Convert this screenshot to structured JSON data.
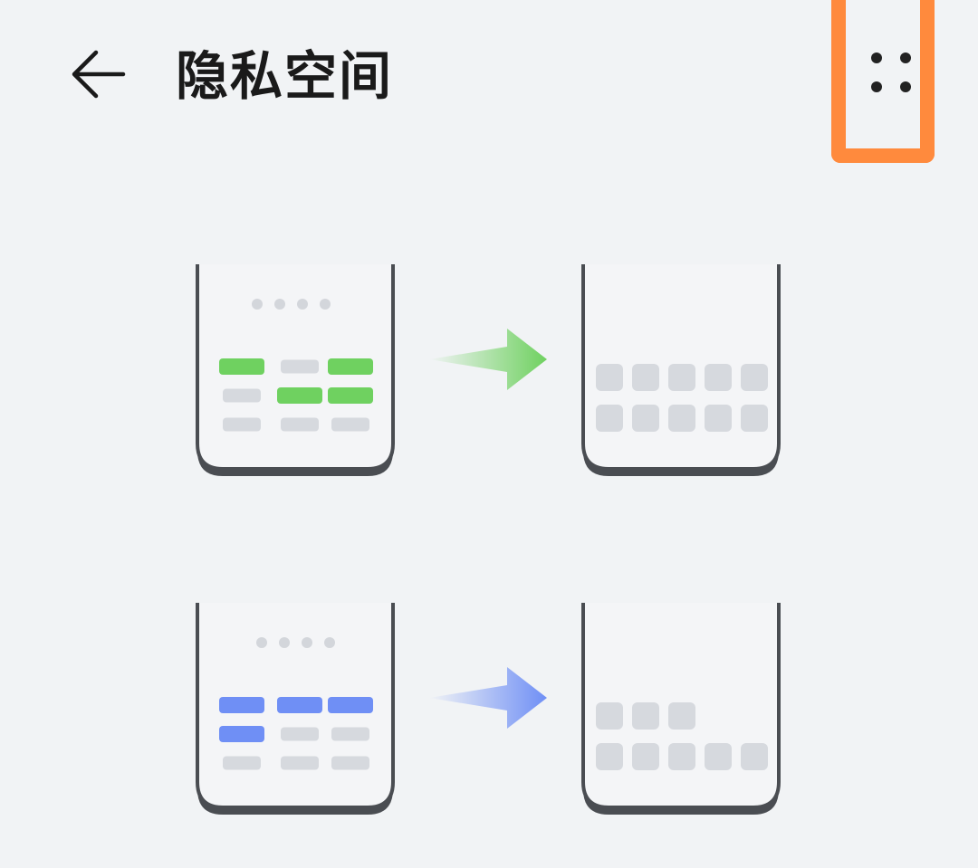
{
  "header": {
    "title": "隐私空间",
    "back_icon": "back-arrow-icon",
    "more_icon": "more-options-icon",
    "highlight_color": "#ff8a3d"
  },
  "illustrations": [
    {
      "name": "transfer-green",
      "accent": "#6fd160",
      "left_phone": {
        "page_dots": 4,
        "grid": [
          [
            "accent",
            "gray",
            "accent"
          ],
          [
            "gray",
            "accent",
            "accent"
          ],
          [
            "gray",
            "gray",
            "gray"
          ]
        ]
      },
      "right_phone": {
        "rows": [
          5,
          5
        ]
      }
    },
    {
      "name": "transfer-blue",
      "accent": "#6f8ff5",
      "left_phone": {
        "page_dots": 4,
        "grid": [
          [
            "accent",
            "accent",
            "accent"
          ],
          [
            "accent",
            "gray",
            "gray"
          ],
          [
            "gray",
            "gray",
            "gray"
          ]
        ]
      },
      "right_phone": {
        "rows": [
          3,
          5
        ]
      }
    }
  ]
}
